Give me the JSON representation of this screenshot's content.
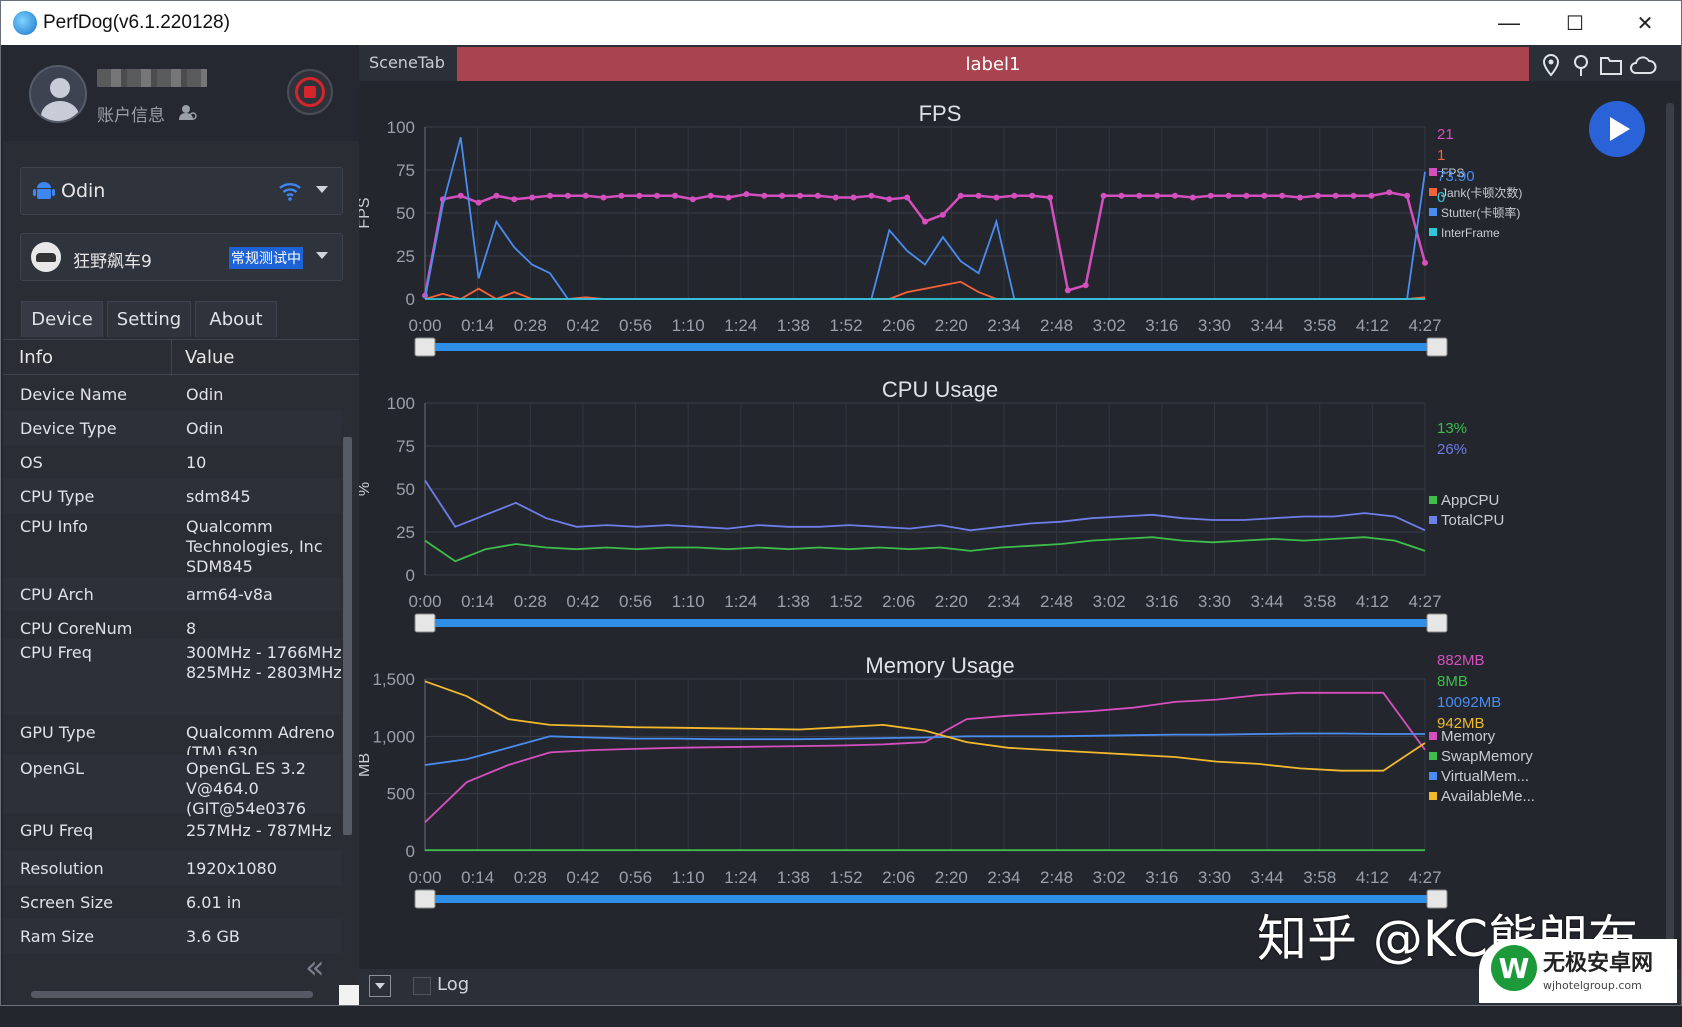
{
  "window": {
    "title": "PerfDog(v6.1.220128)",
    "minimize": "—",
    "maximize": "☐",
    "close": "✕"
  },
  "account": {
    "info_label": "账户信息"
  },
  "device": {
    "name": "Odin"
  },
  "app": {
    "name": "狂野飙车9",
    "status": "常规测试中"
  },
  "tabs": [
    "Device",
    "Setting",
    "About"
  ],
  "table": {
    "col_info": "Info",
    "col_value": "Value",
    "rows": [
      {
        "k": "Device Name",
        "v": "Odin"
      },
      {
        "k": "Device Type",
        "v": "Odin"
      },
      {
        "k": "OS",
        "v": "10"
      },
      {
        "k": "CPU Type",
        "v": "sdm845"
      },
      {
        "k": "CPU Info",
        "v": "Qualcomm Technologies, Inc SDM845"
      },
      {
        "k": "CPU Arch",
        "v": "arm64-v8a"
      },
      {
        "k": "CPU CoreNum",
        "v": "8"
      },
      {
        "k": "CPU Freq",
        "v": "300MHz - 1766MHz 825MHz - 2803MHz"
      },
      {
        "k": "GPU Type",
        "v": "Qualcomm Adreno (TM) 630"
      },
      {
        "k": "OpenGL",
        "v": "OpenGL ES 3.2 V@464.0 (GIT@54e0376"
      },
      {
        "k": "GPU Freq",
        "v": "257MHz - 787MHz"
      },
      {
        "k": "Resolution",
        "v": "1920x1080"
      },
      {
        "k": "Screen Size",
        "v": "6.01 in"
      },
      {
        "k": "Ram Size",
        "v": "3.6 GB"
      }
    ]
  },
  "scene": {
    "tab": "SceneTab",
    "label": "label1"
  },
  "bottom": {
    "log": "Log"
  },
  "watermark": {
    "text": "知乎 @KC熊朗布",
    "site_name": "无极安卓网",
    "site_url": "wjhotelgroup.com"
  },
  "colors": {
    "fps": "#d64fbf",
    "jank": "#f4623a",
    "stutter": "#4a8cf0",
    "interframe": "#2fc7d8",
    "appcpu": "#3dbd4a",
    "totalcpu": "#6f7de8",
    "memory": "#d64fbf",
    "swap": "#3dbd4a",
    "virtual": "#4a8cf0",
    "available": "#f2b92d",
    "scene": "#a8434f",
    "accent": "#2a63d8"
  },
  "icons": {
    "location": "location-pin-icon",
    "marker": "map-marker-icon",
    "folder": "folder-icon",
    "cloud": "cloud-icon",
    "play": "play-icon",
    "stop": "stop-record-icon",
    "android": "android-icon",
    "wifi": "wifi-icon"
  },
  "chart_data": [
    {
      "type": "line",
      "title": "FPS",
      "ylabel": "FPS",
      "ylim": [
        0,
        100
      ],
      "yticks": [
        "0",
        "25",
        "50",
        "75",
        "100"
      ],
      "x": [
        "0:00",
        "0:14",
        "0:28",
        "0:42",
        "0:56",
        "1:10",
        "1:24",
        "1:38",
        "1:52",
        "2:06",
        "2:20",
        "2:34",
        "2:48",
        "3:02",
        "3:16",
        "3:30",
        "3:44",
        "3:58",
        "4:12",
        "4:27"
      ],
      "series": [
        {
          "name": "FPS",
          "current": "21",
          "values": [
            2,
            58,
            60,
            56,
            60,
            58,
            59,
            60,
            60,
            60,
            59,
            60,
            60,
            60,
            60,
            58,
            60,
            59,
            61,
            60,
            60,
            60,
            60,
            59,
            59,
            60,
            58,
            59,
            45,
            49,
            60,
            60,
            59,
            60,
            60,
            59,
            5,
            8,
            60,
            60,
            60,
            60,
            60,
            59,
            60,
            60,
            60,
            60,
            60,
            59,
            60,
            60,
            60,
            60,
            62,
            60,
            21
          ]
        },
        {
          "name": "Jank(卡顿次数)",
          "current": "1",
          "values": [
            0,
            3,
            0,
            6,
            0,
            4,
            0,
            0,
            0,
            1,
            0,
            0,
            0,
            0,
            0,
            0,
            0,
            0,
            0,
            0,
            0,
            0,
            0,
            0,
            0,
            0,
            0,
            4,
            6,
            8,
            10,
            4,
            0,
            0,
            0,
            0,
            0,
            0,
            0,
            0,
            0,
            0,
            0,
            0,
            0,
            0,
            0,
            0,
            0,
            0,
            0,
            0,
            0,
            0,
            0,
            0,
            1
          ]
        },
        {
          "name": "Stutter(卡顿率)",
          "current": "73.90",
          "values": [
            0,
            55,
            94,
            12,
            45,
            30,
            20,
            15,
            0,
            0,
            0,
            0,
            0,
            0,
            0,
            0,
            0,
            0,
            0,
            0,
            0,
            0,
            0,
            0,
            0,
            0,
            40,
            28,
            20,
            36,
            22,
            15,
            45,
            0,
            0,
            0,
            0,
            0,
            0,
            0,
            0,
            0,
            0,
            0,
            0,
            0,
            0,
            0,
            0,
            0,
            0,
            0,
            0,
            0,
            0,
            0,
            74
          ]
        },
        {
          "name": "InterFrame",
          "current": "0",
          "values": [
            0,
            0,
            0,
            0,
            0,
            0,
            0,
            0,
            0,
            0,
            0,
            0,
            0,
            0,
            0,
            0,
            0,
            0,
            0,
            0,
            0,
            0,
            0,
            0,
            0,
            0,
            0,
            0,
            0,
            0,
            0,
            0,
            0,
            0,
            0,
            0,
            0,
            0,
            0,
            0,
            0,
            0,
            0,
            0,
            0,
            0,
            0,
            0,
            0,
            0,
            0,
            0,
            0,
            0,
            0,
            0,
            0
          ]
        }
      ]
    },
    {
      "type": "line",
      "title": "CPU Usage",
      "ylabel": "%",
      "ylim": [
        0,
        100
      ],
      "yticks": [
        "0",
        "25",
        "50",
        "75",
        "100"
      ],
      "x": [
        "0:00",
        "0:14",
        "0:28",
        "0:42",
        "0:56",
        "1:10",
        "1:24",
        "1:38",
        "1:52",
        "2:06",
        "2:20",
        "2:34",
        "2:48",
        "3:02",
        "3:16",
        "3:30",
        "3:44",
        "3:58",
        "4:12",
        "4:27"
      ],
      "series": [
        {
          "name": "AppCPU",
          "current": "13%",
          "values": [
            20,
            8,
            15,
            18,
            16,
            15,
            16,
            15,
            16,
            16,
            15,
            16,
            15,
            16,
            15,
            16,
            15,
            16,
            14,
            16,
            17,
            18,
            20,
            21,
            22,
            20,
            19,
            20,
            21,
            20,
            21,
            22,
            20,
            14
          ]
        },
        {
          "name": "TotalCPU",
          "current": "26%",
          "values": [
            55,
            28,
            35,
            42,
            33,
            28,
            29,
            28,
            29,
            28,
            27,
            29,
            28,
            28,
            29,
            28,
            27,
            29,
            26,
            28,
            30,
            31,
            33,
            34,
            35,
            33,
            32,
            32,
            33,
            34,
            34,
            36,
            34,
            26
          ]
        }
      ]
    },
    {
      "type": "line",
      "title": "Memory Usage",
      "ylabel": "MB",
      "ylim": [
        0,
        1500
      ],
      "yticks": [
        "0",
        "500",
        "1,000",
        "1,500"
      ],
      "x": [
        "0:00",
        "0:14",
        "0:28",
        "0:42",
        "0:56",
        "1:10",
        "1:24",
        "1:38",
        "1:52",
        "2:06",
        "2:20",
        "2:34",
        "2:48",
        "3:02",
        "3:16",
        "3:30",
        "3:44",
        "3:58",
        "4:12",
        "4:27"
      ],
      "series": [
        {
          "name": "Memory",
          "current": "882MB",
          "values": [
            250,
            600,
            750,
            860,
            880,
            890,
            900,
            905,
            910,
            915,
            920,
            930,
            950,
            1150,
            1180,
            1200,
            1220,
            1250,
            1300,
            1320,
            1360,
            1380,
            1380,
            1380,
            882
          ]
        },
        {
          "name": "SwapMemory",
          "current": "8MB",
          "values": [
            8,
            8,
            8,
            8,
            8,
            8,
            8,
            8,
            8,
            8,
            8,
            8,
            8,
            8,
            8,
            8,
            8,
            8,
            8,
            8,
            8,
            8,
            8,
            8,
            8
          ]
        },
        {
          "name": "VirtualMem...",
          "current": "10092MB",
          "values": [
            750,
            800,
            900,
            1000,
            990,
            980,
            980,
            975,
            975,
            975,
            980,
            985,
            990,
            1000,
            1000,
            1000,
            1005,
            1010,
            1015,
            1015,
            1020,
            1025,
            1025,
            1020,
            1020
          ]
        },
        {
          "name": "AvailableMe...",
          "current": "942MB",
          "values": [
            1480,
            1350,
            1150,
            1100,
            1090,
            1080,
            1075,
            1070,
            1065,
            1060,
            1080,
            1100,
            1050,
            950,
            900,
            880,
            860,
            840,
            820,
            780,
            760,
            720,
            700,
            700,
            942
          ]
        }
      ]
    }
  ]
}
